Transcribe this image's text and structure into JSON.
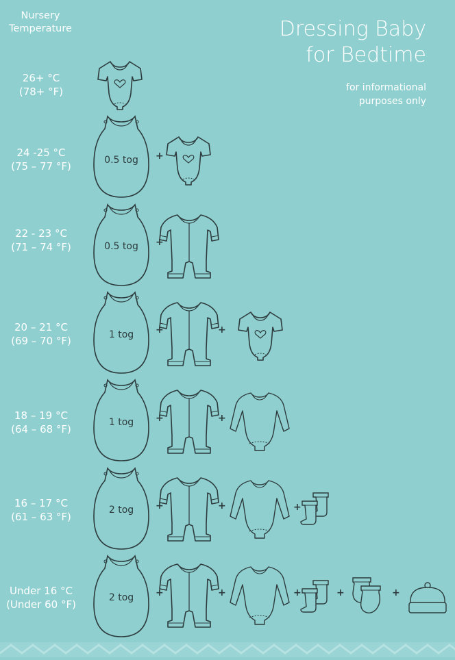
{
  "header": {
    "line1": "Nursery",
    "line2": "Temperature"
  },
  "title": {
    "line1": "Dressing Baby",
    "line2": "for Bedtime"
  },
  "subtitle": {
    "line1": "for informational",
    "line2": "purposes only"
  },
  "plus_sign": "+",
  "rows": [
    {
      "celsius": "26+ °C",
      "fahrenheit": "(78+ °F)",
      "tog": "",
      "items": [
        "bodysuit"
      ]
    },
    {
      "celsius": "24 -25 °C",
      "fahrenheit": "(75 – 77 °F)",
      "tog": "0.5 tog",
      "items": [
        "sleep-sack",
        "bodysuit"
      ]
    },
    {
      "celsius": "22 - 23 °C",
      "fahrenheit": "(71 – 74 °F)",
      "tog": "0.5 tog",
      "items": [
        "sleep-sack",
        "sleepsuit"
      ]
    },
    {
      "celsius": "20 – 21 °C",
      "fahrenheit": "(69 – 70 °F)",
      "tog": "1 tog",
      "items": [
        "sleep-sack",
        "sleepsuit",
        "bodysuit"
      ]
    },
    {
      "celsius": "18 – 19 °C",
      "fahrenheit": "(64 – 68 °F)",
      "tog": "1 tog",
      "items": [
        "sleep-sack",
        "sleepsuit",
        "long-sleeve-bodysuit"
      ]
    },
    {
      "celsius": "16 – 17 °C",
      "fahrenheit": "(61 – 63 °F)",
      "tog": "2 tog",
      "items": [
        "sleep-sack",
        "sleepsuit",
        "long-sleeve-bodysuit",
        "socks"
      ]
    },
    {
      "celsius": "Under 16 °C",
      "fahrenheit": "(Under 60 °F)",
      "tog": "2 tog",
      "items": [
        "sleep-sack",
        "sleepsuit",
        "long-sleeve-bodysuit",
        "socks",
        "mittens",
        "hat"
      ]
    }
  ]
}
